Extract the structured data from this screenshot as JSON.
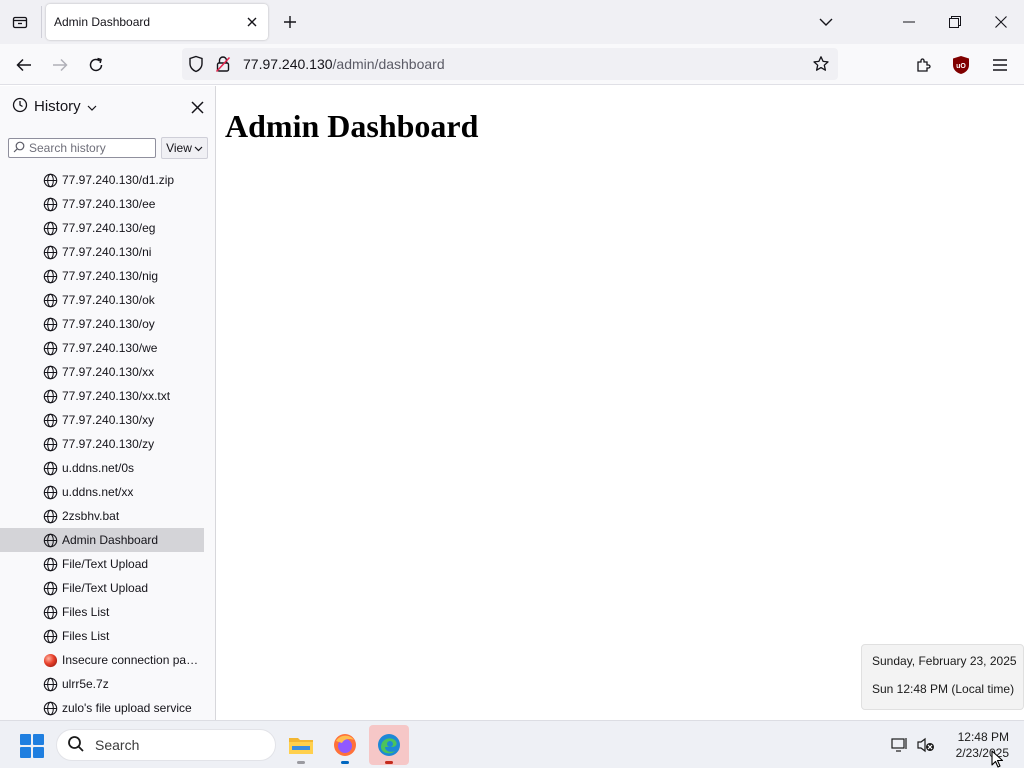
{
  "tab": {
    "title": "Admin Dashboard"
  },
  "urlbar": {
    "host": "77.97.240.130",
    "path": "/admin/dashboard"
  },
  "sidebar": {
    "title": "History",
    "search_placeholder": "Search history",
    "view_label": "View",
    "items": [
      {
        "label": "77.97.240.130/d1.zip",
        "icon": "globe-icon"
      },
      {
        "label": "77.97.240.130/ee",
        "icon": "globe-icon"
      },
      {
        "label": "77.97.240.130/eg",
        "icon": "globe-icon"
      },
      {
        "label": "77.97.240.130/ni",
        "icon": "globe-icon"
      },
      {
        "label": "77.97.240.130/nig",
        "icon": "globe-icon"
      },
      {
        "label": "77.97.240.130/ok",
        "icon": "globe-icon"
      },
      {
        "label": "77.97.240.130/oy",
        "icon": "globe-icon"
      },
      {
        "label": "77.97.240.130/we",
        "icon": "globe-icon"
      },
      {
        "label": "77.97.240.130/xx",
        "icon": "globe-icon"
      },
      {
        "label": "77.97.240.130/xx.txt",
        "icon": "globe-icon"
      },
      {
        "label": "77.97.240.130/xy",
        "icon": "globe-icon"
      },
      {
        "label": "77.97.240.130/zy",
        "icon": "globe-icon"
      },
      {
        "label": "u.ddns.net/0s",
        "icon": "globe-icon"
      },
      {
        "label": "u.ddns.net/xx",
        "icon": "globe-icon"
      },
      {
        "label": "2zsbhv.bat",
        "icon": "globe-icon"
      },
      {
        "label": "Admin Dashboard",
        "icon": "globe-icon",
        "selected": true
      },
      {
        "label": "File/Text Upload",
        "icon": "globe-icon"
      },
      {
        "label": "File/Text Upload",
        "icon": "globe-icon"
      },
      {
        "label": "Files List",
        "icon": "globe-icon"
      },
      {
        "label": "Files List",
        "icon": "globe-icon"
      },
      {
        "label": "Insecure connection pass...",
        "icon": "warning-favicon-icon"
      },
      {
        "label": "ulrr5e.7z",
        "icon": "globe-icon"
      },
      {
        "label": "zulo's file upload service",
        "icon": "globe-icon"
      }
    ]
  },
  "page": {
    "heading": "Admin Dashboard"
  },
  "clock_tooltip": {
    "date_long": "Sunday, February 23, 2025",
    "time_local": "Sun 12:48 PM (Local time)"
  },
  "taskbar": {
    "search_label": "Search",
    "time": "12:48 PM",
    "date": "2/23/2025",
    "apps": [
      "file-explorer-icon",
      "firefox-icon",
      "edge-icon"
    ]
  },
  "colors": {
    "accent": "#1f7fe0",
    "selected_row": "#d4d4d8",
    "active_app_bg": "#f6c7c7"
  }
}
